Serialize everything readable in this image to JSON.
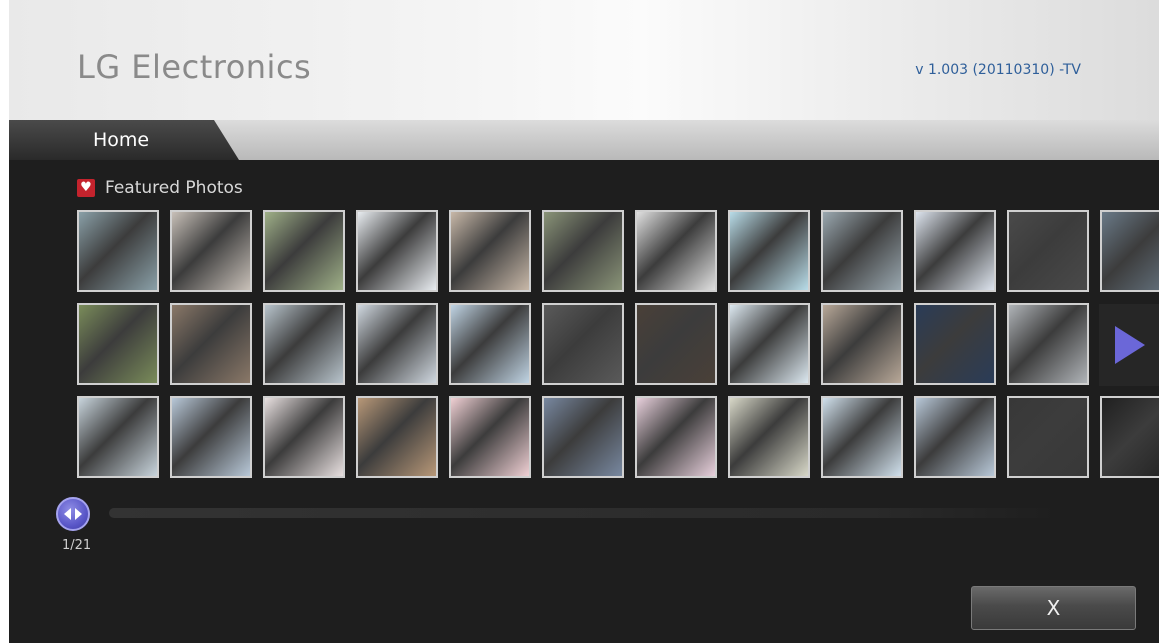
{
  "header": {
    "brand": "LG Electronics",
    "version": "v 1.003 (20110310) -TV"
  },
  "tabs": [
    {
      "label": "Home",
      "active": true
    }
  ],
  "section": {
    "title": "Featured Photos",
    "icon": "heart-icon"
  },
  "gallery": {
    "rows": [
      [
        "#8aa0a8",
        "#c8c0b8",
        "#9fb088",
        "#e8ecf0",
        "#c8b8a8",
        "#8a9478",
        "#e0e0e0",
        "#b8dce8",
        "#9aa8b0",
        "#dde4ee",
        "#4a4a4a",
        "#6a7a88"
      ],
      [
        "#7a8c5a",
        "#8a7868",
        "#b8c4cc",
        "#d0d8e0",
        "#c0d4e4",
        "#5a5a5a",
        "#4a4038",
        "#dce8f0",
        "#b8a898",
        "#2a3c58",
        "#b0b4b8"
      ],
      [
        "#c8d4dc",
        "#b8c8d8",
        "#e8e0e0",
        "#b89878",
        "#f0d0d4",
        "#7888a0",
        "#e8d0dc",
        "#d8d8c8",
        "#d0e0ec",
        "#b8c8d8",
        "#383838",
        "#202020"
      ]
    ],
    "next_icon": "chevron-right-icon"
  },
  "pager": {
    "current": 1,
    "total": 21,
    "text": "1/21",
    "handle_icon": "left-right-arrows-icon"
  },
  "close_button": {
    "label": "X"
  },
  "colors": {
    "accent": "#5a57c8",
    "brand_text": "#8a8a8a",
    "version_text": "#2f5f9a",
    "heart": "#c4232d"
  }
}
